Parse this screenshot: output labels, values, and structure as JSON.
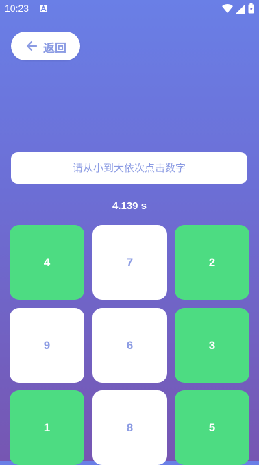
{
  "status_bar": {
    "time": "10:23",
    "icons": [
      "notification-a-icon",
      "wifi-icon",
      "signal-icon",
      "battery-icon"
    ]
  },
  "back_button": {
    "label": "返回",
    "icon": "arrow-left-icon"
  },
  "instruction": "请从小到大依次点击数字",
  "timer": "4.139 s",
  "tiles": [
    {
      "number": "4",
      "state": "clicked"
    },
    {
      "number": "7",
      "state": "pending"
    },
    {
      "number": "2",
      "state": "clicked"
    },
    {
      "number": "9",
      "state": "pending"
    },
    {
      "number": "6",
      "state": "pending"
    },
    {
      "number": "3",
      "state": "clicked"
    },
    {
      "number": "1",
      "state": "clicked"
    },
    {
      "number": "8",
      "state": "pending"
    },
    {
      "number": "5",
      "state": "clicked"
    }
  ],
  "colors": {
    "tile_clicked": "#4ddc82",
    "tile_pending": "#ffffff",
    "accent_text": "#8b9be3",
    "background_top": "#6a7fe6",
    "background_bottom": "#7656b2"
  }
}
